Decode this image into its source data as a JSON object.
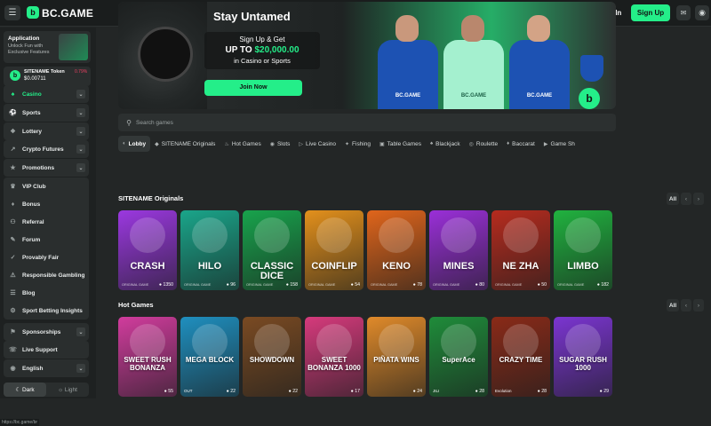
{
  "header": {
    "logo_text": "BC.GAME",
    "signin_label": "Sign In",
    "signup_label": "Sign Up",
    "accent_color": "#24ee89"
  },
  "sidebar": {
    "app_title": "Application",
    "app_subtitle": "Unlock Fun with Exclusive Features",
    "token_name": "SITENAME Token",
    "token_change": "0.79%",
    "token_price": "$0.00711",
    "groups": [
      {
        "items": [
          {
            "label": "Casino",
            "icon": "casino-icon",
            "active": true,
            "chevron": true
          }
        ]
      },
      {
        "items": [
          {
            "label": "Sports",
            "icon": "sports-icon",
            "chevron": true
          }
        ]
      },
      {
        "items": [
          {
            "label": "Lottery",
            "icon": "lottery-icon",
            "chevron": true
          }
        ]
      },
      {
        "items": [
          {
            "label": "Crypto Futures",
            "icon": "futures-icon",
            "chevron": true
          }
        ]
      },
      {
        "items": [
          {
            "label": "Promotions",
            "icon": "promotions-icon",
            "chevron": true
          }
        ]
      },
      {
        "items": [
          {
            "label": "VIP Club",
            "icon": "vip-icon"
          },
          {
            "label": "Bonus",
            "icon": "bonus-icon"
          },
          {
            "label": "Referral",
            "icon": "referral-icon"
          },
          {
            "label": "Forum",
            "icon": "forum-icon"
          },
          {
            "label": "Provably Fair",
            "icon": "fair-icon"
          },
          {
            "label": "Responsible Gambling",
            "icon": "responsible-icon"
          },
          {
            "label": "Blog",
            "icon": "blog-icon"
          },
          {
            "label": "Sport Betting Insights",
            "icon": "insights-icon"
          }
        ]
      },
      {
        "items": [
          {
            "label": "Sponsorships",
            "icon": "sponsorships-icon",
            "chevron": true
          }
        ]
      },
      {
        "items": [
          {
            "label": "Live Support",
            "icon": "support-icon"
          }
        ]
      },
      {
        "items": [
          {
            "label": "English",
            "icon": "language-icon",
            "chevron": true
          }
        ]
      }
    ],
    "theme_dark": "Dark",
    "theme_light": "Light",
    "url_hint": "https://bc.game/br"
  },
  "banner": {
    "title": "Stay Untamed",
    "offer_line1": "Sign Up & Get",
    "offer_up_to": "UP TO ",
    "offer_amount": "$20,000.00",
    "offer_line3": "in Casino or Sports",
    "join_label": "Join Now",
    "player_brand": "BC.GAME"
  },
  "search": {
    "placeholder": "Search games"
  },
  "categories": [
    {
      "label": "Lobby",
      "active": true
    },
    {
      "label": "SITENAME Originals"
    },
    {
      "label": "Hot Games"
    },
    {
      "label": "Slots"
    },
    {
      "label": "Live Casino"
    },
    {
      "label": "Fishing"
    },
    {
      "label": "Table Games"
    },
    {
      "label": "Blackjack"
    },
    {
      "label": "Roulette"
    },
    {
      "label": "Baccarat"
    },
    {
      "label": "Game Sh"
    }
  ],
  "originals": {
    "title": "SITENAME Originals",
    "all_label": "All",
    "tag": "ORIGINAL GAME",
    "games": [
      {
        "name": "CRASH",
        "count": "1350",
        "color": "#9b38e0"
      },
      {
        "name": "HILO",
        "count": "96",
        "color": "#1aa58a"
      },
      {
        "name": "CLASSIC DICE",
        "count": "158",
        "color": "#18a34c"
      },
      {
        "name": "COINFLIP",
        "count": "54",
        "color": "#e3901c"
      },
      {
        "name": "KENO",
        "count": "78",
        "color": "#e0651b"
      },
      {
        "name": "MINES",
        "count": "80",
        "color": "#9a2fd8"
      },
      {
        "name": "NE ZHA",
        "count": "50",
        "color": "#b62b1e"
      },
      {
        "name": "LIMBO",
        "count": "182",
        "color": "#20b23f"
      }
    ]
  },
  "hot_games": {
    "title": "Hot Games",
    "all_label": "All",
    "games": [
      {
        "name": "SWEET RUSH BONANZA",
        "provider": "",
        "count": "55",
        "color": "#d13c9d"
      },
      {
        "name": "MEGA BLOCK",
        "provider": "OUT",
        "count": "22",
        "color": "#1f8fbf"
      },
      {
        "name": "SHOWDOWN",
        "provider": "",
        "count": "22",
        "color": "#7a4a22"
      },
      {
        "name": "SWEET BONANZA 1000",
        "provider": "",
        "count": "17",
        "color": "#d63a7c"
      },
      {
        "name": "PIÑATA WINS",
        "provider": "",
        "count": "24",
        "color": "#e08a2a"
      },
      {
        "name": "SuperAce",
        "provider": "JILI",
        "count": "28",
        "color": "#1f8c3a"
      },
      {
        "name": "CRAZY TIME",
        "provider": "Evolution",
        "count": "28",
        "color": "#8a2a18"
      },
      {
        "name": "SUGAR RUSH 1000",
        "provider": "",
        "count": "29",
        "color": "#7b35d1"
      }
    ]
  }
}
